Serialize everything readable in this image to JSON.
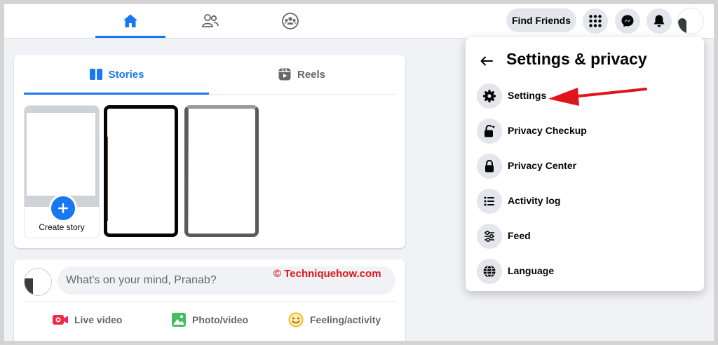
{
  "topnav": {
    "tabs": [
      {
        "name": "home",
        "icon": "home-icon",
        "active": true
      },
      {
        "name": "friends",
        "icon": "friends-icon",
        "active": false
      },
      {
        "name": "groups",
        "icon": "groups-icon",
        "active": false
      }
    ],
    "find_friends_label": "Find Friends",
    "icons": [
      "menu-grid-icon",
      "messenger-icon",
      "notifications-bell-icon"
    ]
  },
  "stories": {
    "tabs": [
      {
        "label": "Stories",
        "icon": "stories-book-icon",
        "active": true
      },
      {
        "label": "Reels",
        "icon": "reels-icon",
        "active": false
      }
    ],
    "create_label": "Create story"
  },
  "composer": {
    "placeholder": "What's on your mind, Pranab?",
    "actions": [
      {
        "label": "Live video",
        "icon": "live-video-icon",
        "color": "#f02849"
      },
      {
        "label": "Photo/video",
        "icon": "photo-video-icon",
        "color": "#45bd62"
      },
      {
        "label": "Feeling/activity",
        "icon": "feeling-emoji-icon",
        "color": "#f7b928"
      }
    ]
  },
  "watermark": "© Techniquehow.com",
  "settings_menu": {
    "title": "Settings & privacy",
    "items": [
      {
        "label": "Settings",
        "icon": "gear-icon"
      },
      {
        "label": "Privacy Checkup",
        "icon": "lock-heart-icon"
      },
      {
        "label": "Privacy Center",
        "icon": "lock-icon"
      },
      {
        "label": "Activity log",
        "icon": "list-icon"
      },
      {
        "label": "Feed",
        "icon": "sliders-icon"
      },
      {
        "label": "Language",
        "icon": "globe-icon"
      }
    ]
  },
  "colors": {
    "accent": "#1877f2",
    "annotation_arrow": "#e0151c",
    "background": "#f0f2f5"
  }
}
